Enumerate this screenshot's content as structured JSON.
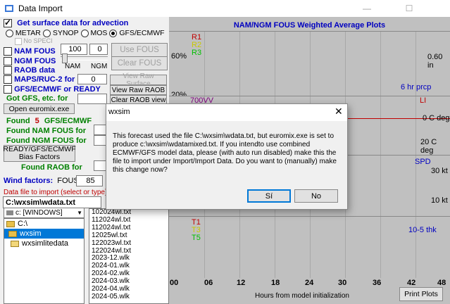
{
  "window": {
    "title": "Data Import"
  },
  "left": {
    "surface": {
      "label": "Get surface data for advection",
      "checked": true
    },
    "source_radios": [
      {
        "label": "METAR",
        "selected": false
      },
      {
        "label": "SYNOP",
        "selected": false
      },
      {
        "label": "MOS",
        "selected": false
      },
      {
        "label": "GFS/ECMWF",
        "selected": true
      }
    ],
    "no_speci": "No SPECI",
    "checks": {
      "nam_fous": "NAM FOUS",
      "ngm_fous": "NGM FOUS",
      "raob_data": "RAOB data",
      "maps_ruc": "MAPS/RUC-2 for",
      "gfs_ecmwf_ready": "GFS/ECMWF or READY"
    },
    "nam_value": "100",
    "ngm_value": "0",
    "nam_label": "NAM",
    "ngm_label": "NGM",
    "maps_value": "0",
    "use_fous": "Use FOUS",
    "clear_fous": "Clear FOUS",
    "view_raw_surface": "View Raw Surface",
    "view_raw_raob": "View Raw RAOB",
    "clear_raob_view": "Clear RAOB view",
    "got_gfs": "Got GFS, etc. for",
    "open_euromix": "Open euromix.exe",
    "found_label": "Found",
    "found_count": "5",
    "found_what": "GFS/ECMWF",
    "found_nam": "Found NAM FOUS for",
    "found_ngm": "Found NGM FOUS for",
    "bias_btn_line1": "READY/GFS/ECMWF",
    "bias_btn_line2": "Bias Factors",
    "found_raob": "Found RAOB for",
    "wind_factors": "Wind factors:",
    "fous_label": "FOUS",
    "fous_value": "85",
    "data_file_label": "Data file to import (select or type)",
    "data_file_value": "C:\\wxsim\\wdata.txt",
    "drive": "c: [WINDOWS]",
    "dirs": [
      "C:\\",
      "wxsim",
      "wxsimlitedata"
    ],
    "selected_dir": "wxsim",
    "files": [
      "102024wl.txt",
      "112024wl.txt",
      "112024wl.txt",
      "12025wl.txt",
      "122023wl.txt",
      "122024wl.txt",
      "2023-12.wlk",
      "2024-01.wlk",
      "2024-02.wlk",
      "2024-03.wlk",
      "2024-04.wlk",
      "2024-05.wlk"
    ]
  },
  "plots": {
    "title": "NAM/NGM FOUS Weighted Average Plots",
    "panel1": {
      "legend": [
        "R1",
        "R2",
        "R3"
      ],
      "legend_colors": [
        "#c00000",
        "#c8c800",
        "#00c000"
      ],
      "y_left_top": "60%",
      "y_left_bottom": "20%",
      "right_val": "0.60 in",
      "right_label": "6 hr prcp"
    },
    "panel2": {
      "legend": "700VV",
      "right_label": "LI",
      "val1": "0 C deg",
      "val2": "20 C deg"
    },
    "panel3": {
      "right_label": "SPD",
      "val1": "30 kt",
      "val2": "10 kt"
    },
    "panel4": {
      "legend": [
        "T1",
        "T3",
        "T5"
      ],
      "legend_colors": [
        "#c00000",
        "#c8c800",
        "#00c000"
      ],
      "right_label": "10-5 thk"
    },
    "x_ticks": [
      "00",
      "06",
      "12",
      "18",
      "24",
      "30",
      "36",
      "42",
      "48"
    ],
    "x_label": "Hours from model initialization",
    "print_btn": "Print Plots"
  },
  "dialog": {
    "title": "wxsim",
    "message": "This forecast used the file C:\\wxsim\\wdata.txt, but euromix.exe is set to produce c:\\wxsim\\wdatamixed.txt.  If you intendto use combined ECMWF/GFS model data, please (with auto run disabled) make this the file to import under Import/Import Data.  Do you want to (manually) make this change now?",
    "yes_label": "Sí",
    "no_label": "No"
  }
}
